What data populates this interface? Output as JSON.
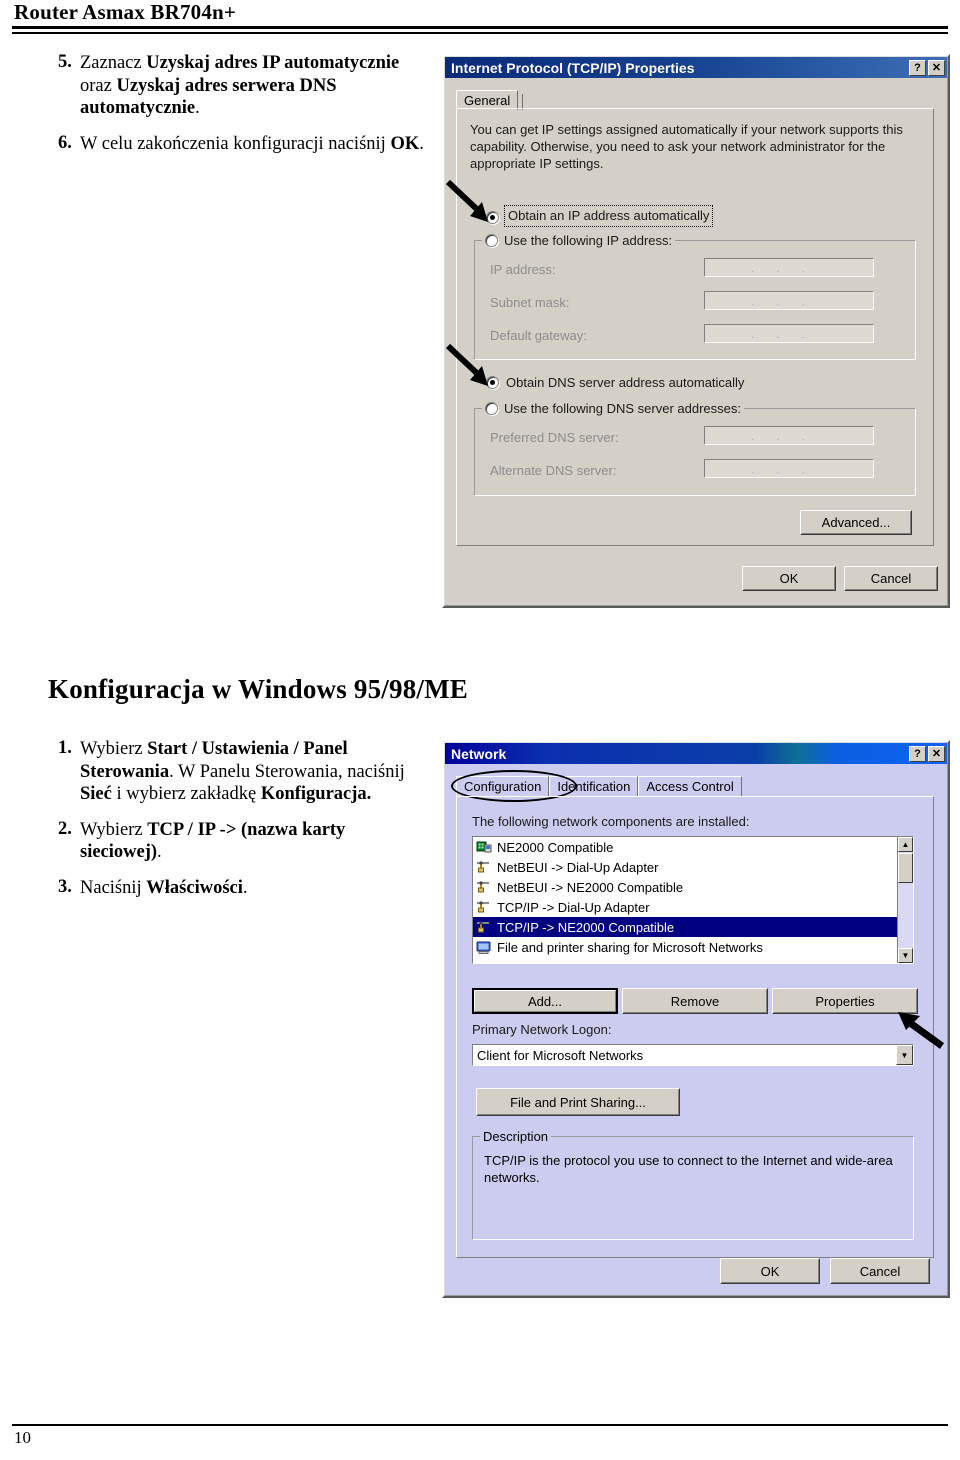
{
  "document": {
    "header_title": "Router Asmax BR704n+",
    "page_number": "10"
  },
  "section_heading": "Konfiguracja w Windows 95/98/ME",
  "steps_top": [
    {
      "num": "5.",
      "html": "Zaznacz <b>Uzyskaj adres IP automatycznie</b> oraz <b>Uzyskaj adres serwera DNS automatycznie</b>."
    },
    {
      "num": "6.",
      "html": "W celu zakończenia konfiguracji naciśnij <b>OK</b>."
    }
  ],
  "steps_bottom": [
    {
      "num": "1.",
      "html": "Wybierz <b>Start / Ustawienia / Panel Sterowania</b>. W Panelu Sterowania, naciśnij <b>Sieć</b> i wybierz zakładkę <b>Konfiguracja.</b>"
    },
    {
      "num": "2.",
      "html": "Wybierz <b>TCP / IP -&gt; (nazwa karty sieciowej)</b>."
    },
    {
      "num": "3.",
      "html": "Naciśnij <b>Właściwości</b>."
    }
  ],
  "tcpip_dialog": {
    "title": "Internet Protocol (TCP/IP) Properties",
    "titlebar_color": "#0b2a7a",
    "face_color": "#d4d0c8",
    "help_button": "?",
    "close_button": "✕",
    "tabs": [
      {
        "label": "General",
        "active": true
      }
    ],
    "description": "You can get IP settings assigned automatically if your network supports this capability. Otherwise, you need to ask your network administrator for the appropriate IP settings.",
    "radio_auto_ip": {
      "label": "Obtain an IP address automatically",
      "selected": true
    },
    "radio_manual_ip": {
      "label": "Use the following IP address:",
      "selected": false
    },
    "ip_fields": [
      {
        "label": "IP address:",
        "value": ""
      },
      {
        "label": "Subnet mask:",
        "value": ""
      },
      {
        "label": "Default gateway:",
        "value": ""
      }
    ],
    "radio_auto_dns": {
      "label": "Obtain DNS server address automatically",
      "selected": true
    },
    "radio_manual_dns": {
      "label": "Use the following DNS server addresses:",
      "selected": false
    },
    "dns_fields": [
      {
        "label": "Preferred DNS server:",
        "value": ""
      },
      {
        "label": "Alternate DNS server:",
        "value": ""
      }
    ],
    "advanced_button": "Advanced...",
    "ok_button": "OK",
    "cancel_button": "Cancel"
  },
  "network_dialog": {
    "title": "Network",
    "titlebar_color": "#0a1fa8",
    "face_color": "#ccccf0",
    "help_button": "?",
    "close_button": "✕",
    "tabs": [
      {
        "label": "Configuration",
        "active": true,
        "circled": true
      },
      {
        "label": "Identification",
        "active": false
      },
      {
        "label": "Access Control",
        "active": false
      }
    ],
    "components_label": "The following network components are installed:",
    "components": [
      {
        "label": "NE2000 Compatible",
        "icon": "adapter-icon",
        "selected": false
      },
      {
        "label": "NetBEUI -> Dial-Up Adapter",
        "icon": "protocol-icon",
        "selected": false
      },
      {
        "label": "NetBEUI -> NE2000 Compatible",
        "icon": "protocol-icon",
        "selected": false
      },
      {
        "label": "TCP/IP -> Dial-Up Adapter",
        "icon": "protocol-icon",
        "selected": false
      },
      {
        "label": "TCP/IP -> NE2000 Compatible",
        "icon": "protocol-icon",
        "selected": true
      },
      {
        "label": "File and printer sharing for Microsoft Networks",
        "icon": "service-icon",
        "selected": false
      }
    ],
    "add_button": "Add...",
    "remove_button": "Remove",
    "properties_button": "Properties",
    "primary_logon_label": "Primary Network Logon:",
    "primary_logon_value": "Client for Microsoft Networks",
    "file_print_button": "File and Print Sharing...",
    "description_caption": "Description",
    "description_text": "TCP/IP is the protocol you use to connect to the Internet and wide-area networks.",
    "ok_button": "OK",
    "cancel_button": "Cancel"
  }
}
